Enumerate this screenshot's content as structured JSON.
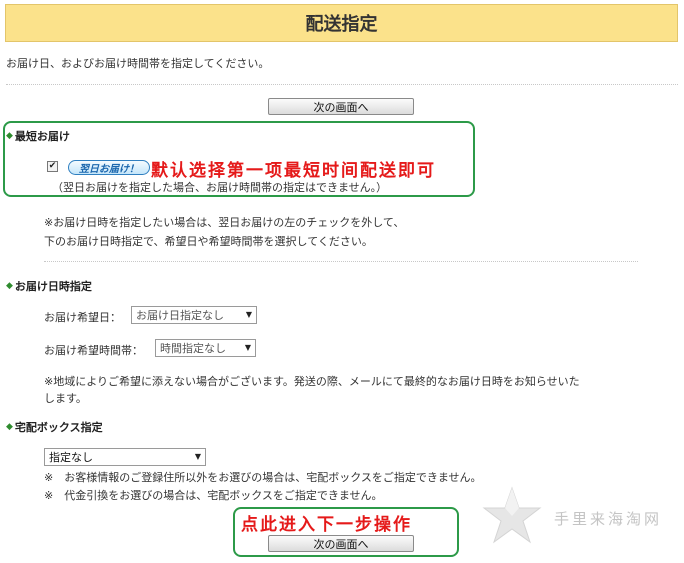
{
  "header": {
    "title": "配送指定"
  },
  "intro": "お届け日、およびお届け時間帯を指定してください。",
  "buttons": {
    "next_label": "次の画面へ"
  },
  "fastest": {
    "section_title": "最短お届け",
    "checkbox_mark": "✔",
    "badge": "翌日お届け！",
    "paren_note": "（翌日お届けを指定した場合、お届け時間帯の指定はできません。）",
    "note_line1": "※お届け日時を指定したい場合は、翌日お届けの左のチェックを外して、",
    "note_line2": "下のお届け日時指定で、希望日や希望時間帯を選択してください。"
  },
  "datetime": {
    "section_title": "お届け日時指定",
    "date_label": "お届け希望日：",
    "date_value": "お届け日指定なし",
    "time_label": "お届け希望時間帯：",
    "time_value": "時間指定なし",
    "note_line1": "※地域によりご希望に添えない場合がございます。発送の際、メールにて最終的なお届け日時をお知らせいた",
    "note_line2": "します。"
  },
  "delivery_box": {
    "section_title": "宅配ボックス指定",
    "select_value": "指定なし",
    "note1": "※　お客様情報のご登録住所以外をお選びの場合は、宅配ボックスをご指定できません。",
    "note2": "※　代金引換をお選びの場合は、宅配ボックスをご指定できません。"
  },
  "annotations": {
    "annot1": "默认选择第一项最短时间配送即可",
    "annot2": "点此进入下一步操作"
  },
  "watermark": {
    "text": "手里来海淘网"
  },
  "icons": {
    "section_marker": "green-diamond-icon",
    "select_caret": "triangle-down-icon",
    "watermark_star": "star-icon"
  },
  "colors": {
    "header_bg": "#fbe28b",
    "annotation_red": "#e51a1a",
    "highlight_green": "#2c9a48",
    "badge_blue": "#1c67ad"
  }
}
